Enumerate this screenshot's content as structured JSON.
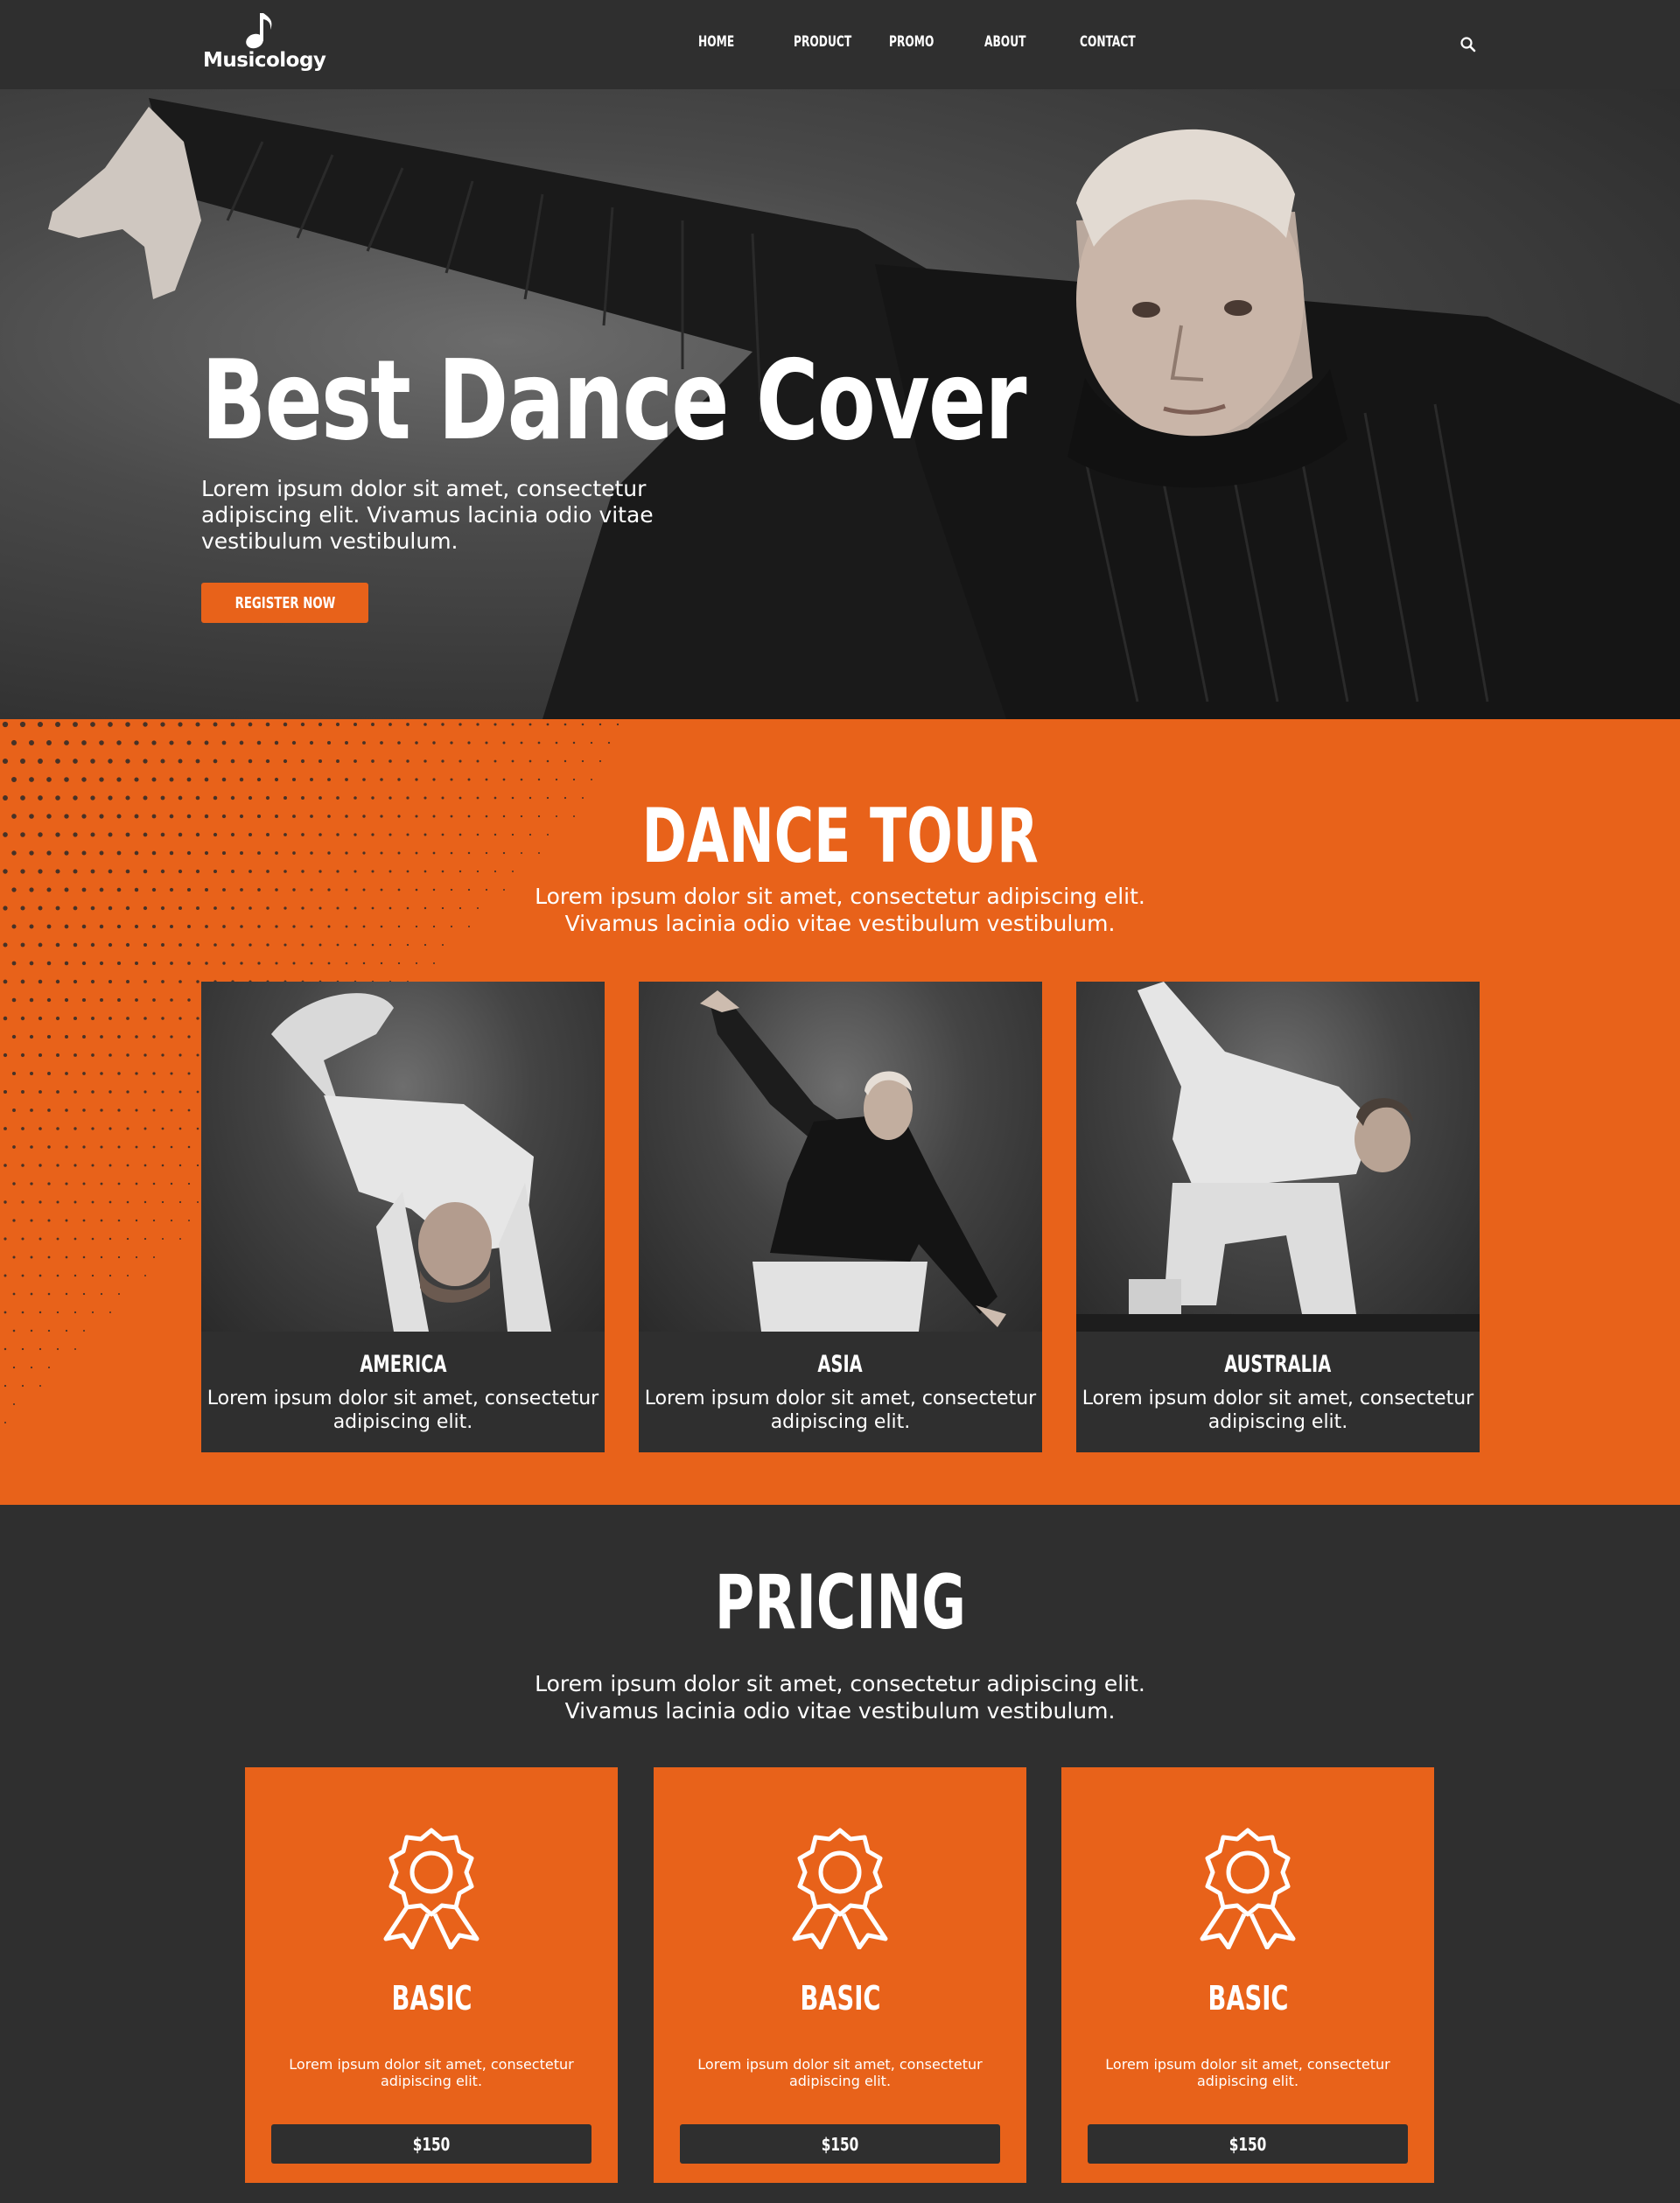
{
  "brand": {
    "name": "Musicology"
  },
  "nav": {
    "items": [
      "HOME",
      "PRODUCT",
      "PROMO",
      "ABOUT",
      "CONTACT"
    ]
  },
  "hero": {
    "title": "Best Dance Cover",
    "text": "Lorem ipsum dolor sit amet, consectetur adipiscing elit. Vivamus lacinia odio vitae vestibulum vestibulum.",
    "button": "REGISTER NOW"
  },
  "tour": {
    "title": "DANCE TOUR",
    "subtitle_line1": "Lorem ipsum dolor sit amet, consectetur adipiscing elit.",
    "subtitle_line2": "Vivamus lacinia odio vitae vestibulum vestibulum.",
    "cards": [
      {
        "name": "AMERICA",
        "desc": "Lorem ipsum dolor sit amet, consectetur adipiscing elit."
      },
      {
        "name": "ASIA",
        "desc": "Lorem ipsum dolor sit amet, consectetur adipiscing elit."
      },
      {
        "name": "AUSTRALIA",
        "desc": "Lorem ipsum dolor sit amet, consectetur adipiscing elit."
      }
    ]
  },
  "pricing": {
    "title": "PRICING",
    "subtitle_line1": "Lorem ipsum dolor sit amet, consectetur adipiscing elit.",
    "subtitle_line2": "Vivamus lacinia odio vitae vestibulum vestibulum.",
    "plans": [
      {
        "name": "BASIC",
        "desc": "Lorem ipsum dolor sit amet, consectetur adipiscing elit.",
        "price": "$150"
      },
      {
        "name": "BASIC",
        "desc": "Lorem ipsum dolor sit amet, consectetur adipiscing elit.",
        "price": "$150"
      },
      {
        "name": "BASIC",
        "desc": "Lorem ipsum dolor sit amet, consectetur adipiscing elit.",
        "price": "$150"
      }
    ]
  },
  "colors": {
    "accent": "#e8621a",
    "dark": "#2f2f2f",
    "text": "#ffffff"
  },
  "icons": [
    "music-note-icon",
    "search-icon",
    "award-ribbon-icon"
  ]
}
